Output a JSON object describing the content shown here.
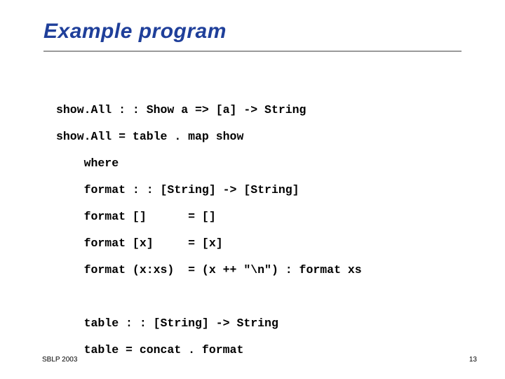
{
  "title": "Example program",
  "code": {
    "l1": "show.All : : Show a => [a] -> String",
    "l2": "show.All = table . map show",
    "l3": "    where",
    "l4": "    format : : [String] -> [String]",
    "l5": "    format []      = []",
    "l6": "    format [x]     = [x]",
    "l7": "    format (x:xs)  = (x ++ \"\\n\") : format xs",
    "l8": "",
    "l9": "    table : : [String] -> String",
    "l10": "    table = concat . format"
  },
  "footer": {
    "left": "SBLP 2003",
    "right": "13"
  }
}
